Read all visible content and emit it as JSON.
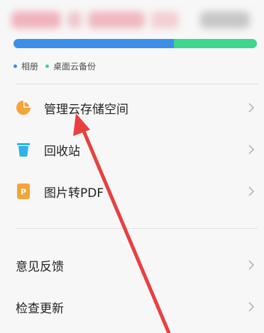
{
  "colors": {
    "accent_blue": "#3b8fe8",
    "accent_green": "#3dd68c",
    "icon_orange": "#f5a33a",
    "icon_blue": "#2eb3e6",
    "arrow_red": "#e84040"
  },
  "storage": {
    "photos_fraction": 0.66,
    "desktop_fraction": 0.34
  },
  "legend": {
    "photos": "相册",
    "desktop_backup": "桌面云备份"
  },
  "menu": [
    {
      "label": "管理云存储空间",
      "icon": "pie-chart-icon"
    },
    {
      "label": "回收站",
      "icon": "trash-icon"
    },
    {
      "label": "图片转PDF",
      "icon": "pdf-icon"
    }
  ],
  "secondary": [
    {
      "label": "意见反馈"
    },
    {
      "label": "检查更新"
    }
  ]
}
